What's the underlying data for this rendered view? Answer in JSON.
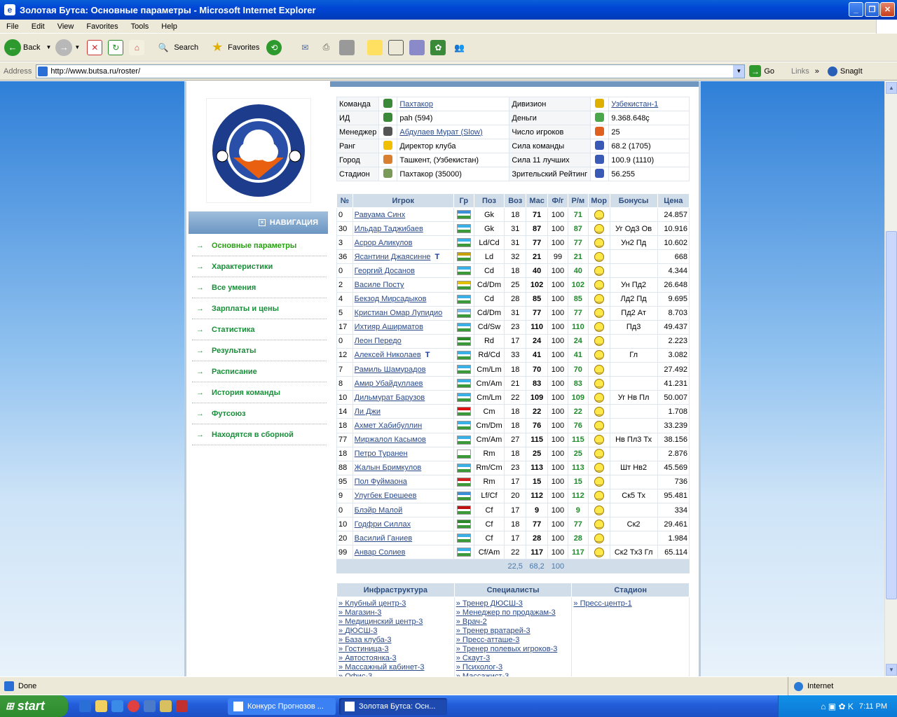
{
  "window": {
    "title": "Золотая Бутса: Основные параметры - Microsoft Internet Explorer"
  },
  "menu": [
    "File",
    "Edit",
    "View",
    "Favorites",
    "Tools",
    "Help"
  ],
  "toolbar": {
    "back": "Back",
    "search": "Search",
    "favorites": "Favorites"
  },
  "address": {
    "label": "Address",
    "url": "http://www.butsa.ru/roster/",
    "go": "Go",
    "links": "Links",
    "snagit": "SnagIt"
  },
  "nav": {
    "header": "НАВИГАЦИЯ",
    "items": [
      "Основные параметры",
      "Характеристики",
      "Все умения",
      "Зарплаты и цены",
      "Статистика",
      "Результаты",
      "Расписание",
      "История команды",
      "Футсоюз",
      "Находятся в сборной"
    ]
  },
  "info": {
    "rows": [
      {
        "l": "Команда",
        "v": "Пахтакор",
        "l2": "Дивизион",
        "v2": "Узбекистан-1"
      },
      {
        "l": "ИД",
        "v": "pah (594)",
        "l2": "Деньги",
        "v2": "9.368.648ç"
      },
      {
        "l": "Менеджер",
        "v": "Абдулаев Мурат (Slow)",
        "l2": "Число игроков",
        "v2": "25"
      },
      {
        "l": "Ранг",
        "v": "Директор клуба",
        "l2": "Сила команды",
        "v2": "68.2 (1705)"
      },
      {
        "l": "Город",
        "v": "Ташкент, (Узбекистан)",
        "l2": "Сила 11 лучших",
        "v2": "100.9 (1110)"
      },
      {
        "l": "Стадион",
        "v": "Пахтакор (35000)",
        "l2": "Зрительский Рейтинг",
        "v2": "56.255"
      }
    ]
  },
  "roster": {
    "headers": [
      "№",
      "Игрок",
      "Гр",
      "Поз",
      "Воз",
      "Мас",
      "Ф/г",
      "Р/м",
      "Мор",
      "Бонусы",
      "Цена"
    ],
    "rows": [
      {
        "n": "0",
        "name": "Равуама Синх",
        "pos": "Gk",
        "age": "18",
        "mas": "71",
        "fg": "100",
        "rm": "71",
        "bon": "",
        "price": "24.857"
      },
      {
        "n": "30",
        "name": "Ильдар Таджибаев",
        "pos": "Gk",
        "age": "31",
        "mas": "87",
        "fg": "100",
        "rm": "87",
        "bon": "Уг Од3 Ов",
        "price": "10.916"
      },
      {
        "n": "3",
        "name": "Асрор Аликулов",
        "pos": "Ld/Cd",
        "age": "31",
        "mas": "77",
        "fg": "100",
        "rm": "77",
        "bon": "Ун2 Пд",
        "price": "10.602"
      },
      {
        "n": "36",
        "name": "Ясантини Джаясинне",
        "tr": "T",
        "pos": "Ld",
        "age": "32",
        "mas": "21",
        "fg": "99",
        "rm": "21",
        "bon": "",
        "price": "668"
      },
      {
        "n": "0",
        "name": "Георгий Досанов",
        "pos": "Cd",
        "age": "18",
        "mas": "40",
        "fg": "100",
        "rm": "40",
        "bon": "",
        "price": "4.344"
      },
      {
        "n": "2",
        "name": "Василе Посту",
        "pos": "Cd/Dm",
        "age": "25",
        "mas": "102",
        "fg": "100",
        "rm": "102",
        "bon": "Ун Пд2",
        "price": "26.648"
      },
      {
        "n": "4",
        "name": "Бекзод Мирсадыков",
        "pos": "Cd",
        "age": "28",
        "mas": "85",
        "fg": "100",
        "rm": "85",
        "bon": "Лд2 Пд",
        "price": "9.695"
      },
      {
        "n": "5",
        "name": "Кристиан Омар Лупидио",
        "pos": "Cd/Dm",
        "age": "31",
        "mas": "77",
        "fg": "100",
        "rm": "77",
        "bon": "Пд2 Ат",
        "price": "8.703"
      },
      {
        "n": "17",
        "name": "Ихтияр Аширматов",
        "pos": "Cd/Sw",
        "age": "23",
        "mas": "110",
        "fg": "100",
        "rm": "110",
        "bon": "Пд3",
        "price": "49.437"
      },
      {
        "n": "0",
        "name": "Леон Передо",
        "pos": "Rd",
        "age": "17",
        "mas": "24",
        "fg": "100",
        "rm": "24",
        "bon": "",
        "price": "2.223"
      },
      {
        "n": "12",
        "name": "Алексей Николаев",
        "tr": "T",
        "pos": "Rd/Cd",
        "age": "33",
        "mas": "41",
        "fg": "100",
        "rm": "41",
        "bon": "Гл",
        "price": "3.082"
      },
      {
        "n": "7",
        "name": "Рамиль Шамурадов",
        "pos": "Cm/Lm",
        "age": "18",
        "mas": "70",
        "fg": "100",
        "rm": "70",
        "bon": "",
        "price": "27.492"
      },
      {
        "n": "8",
        "name": "Амир Убайдуллаев",
        "pos": "Cm/Am",
        "age": "21",
        "mas": "83",
        "fg": "100",
        "rm": "83",
        "bon": "",
        "price": "41.231"
      },
      {
        "n": "10",
        "name": "Дильмурат Барузов",
        "pos": "Cm/Lm",
        "age": "22",
        "mas": "109",
        "fg": "100",
        "rm": "109",
        "bon": "Уг Нв Пл",
        "price": "50.007"
      },
      {
        "n": "14",
        "name": "Ли Джи",
        "pos": "Cm",
        "age": "18",
        "mas": "22",
        "fg": "100",
        "rm": "22",
        "bon": "",
        "price": "1.708"
      },
      {
        "n": "18",
        "name": "Ахмет Хабибуллин",
        "pos": "Cm/Dm",
        "age": "18",
        "mas": "76",
        "fg": "100",
        "rm": "76",
        "bon": "",
        "price": "33.239"
      },
      {
        "n": "77",
        "name": "Миржалол Касымов",
        "pos": "Cm/Am",
        "age": "27",
        "mas": "115",
        "fg": "100",
        "rm": "115",
        "bon": "Нв Пл3 Тх",
        "price": "38.156"
      },
      {
        "n": "18",
        "name": "Петро Туранен",
        "pos": "Rm",
        "age": "18",
        "mas": "25",
        "fg": "100",
        "rm": "25",
        "bon": "",
        "price": "2.876"
      },
      {
        "n": "88",
        "name": "Жалын Бримкулов",
        "pos": "Rm/Cm",
        "age": "23",
        "mas": "113",
        "fg": "100",
        "rm": "113",
        "bon": "Шт Нв2",
        "price": "45.569"
      },
      {
        "n": "95",
        "name": "Пол Фуймаона",
        "pos": "Rm",
        "age": "17",
        "mas": "15",
        "fg": "100",
        "rm": "15",
        "bon": "",
        "price": "736"
      },
      {
        "n": "9",
        "name": "Улугбек Ерешеев",
        "pos": "Lf/Cf",
        "age": "20",
        "mas": "112",
        "fg": "100",
        "rm": "112",
        "bon": "Ск5 Тх",
        "price": "95.481"
      },
      {
        "n": "0",
        "name": "Блэйр Малой",
        "pos": "Cf",
        "age": "17",
        "mas": "9",
        "fg": "100",
        "rm": "9",
        "bon": "",
        "price": "334"
      },
      {
        "n": "10",
        "name": "Годфри Силлах",
        "pos": "Cf",
        "age": "18",
        "mas": "77",
        "fg": "100",
        "rm": "77",
        "bon": "Ск2",
        "price": "29.461"
      },
      {
        "n": "20",
        "name": "Василий Ганиев",
        "pos": "Cf",
        "age": "17",
        "mas": "28",
        "fg": "100",
        "rm": "28",
        "bon": "",
        "price": "1.984"
      },
      {
        "n": "99",
        "name": "Анвар Солиев",
        "pos": "Cf/Am",
        "age": "22",
        "mas": "117",
        "fg": "100",
        "rm": "117",
        "bon": "Ск2 Тх3 Гл",
        "price": "65.114"
      }
    ],
    "flags": [
      "#3a8fd8",
      "#3ab0e8",
      "#3ab0e8",
      "#c8a000",
      "#3ab0e8",
      "#e0c000",
      "#3ab0e8",
      "#7bb8e8",
      "#3ab0e8",
      "#2a8a2a",
      "#3ab0e8",
      "#3ab0e8",
      "#3ab0e8",
      "#3ab0e8",
      "#e01010",
      "#3ab0e8",
      "#3ab0e8",
      "#ffffff",
      "#3ab0e8",
      "#d02020",
      "#3a8fd8",
      "#c01010",
      "#2a8a2a",
      "#3ab0e8",
      "#3ab0e8"
    ],
    "totals": {
      "age": "22,5",
      "mas": "68,2",
      "fg": "100"
    }
  },
  "bottom": {
    "headers": [
      "Инфраструктура",
      "Специалисты",
      "Стадион"
    ],
    "infra": [
      "Клубный центр-3",
      "Магазин-3",
      "Медицинский центр-3",
      "ДЮСШ-3",
      "База клуба-3",
      "Гостиница-3",
      "Автостоянка-3",
      "Массажный кабинет-3",
      "Офис-3"
    ],
    "spec": [
      "Тренер ДЮСШ-3",
      "Менеджер по продажам-3",
      "Врач-2",
      "Тренер вратарей-3",
      "Пресс-атташе-3",
      "Тренер полевых игроков-3",
      "Скаут-3",
      "Психолог-3",
      "Массажист-3"
    ],
    "stadium": [
      "Пресс-центр-1"
    ]
  },
  "status": {
    "text": "Done",
    "zone": "Internet"
  },
  "taskbar": {
    "start": "start",
    "tasks": [
      "Конкурс Прогнозов ...",
      "Золотая Бутса: Осн..."
    ],
    "lang": "RU",
    "time": "7:11 PM"
  }
}
